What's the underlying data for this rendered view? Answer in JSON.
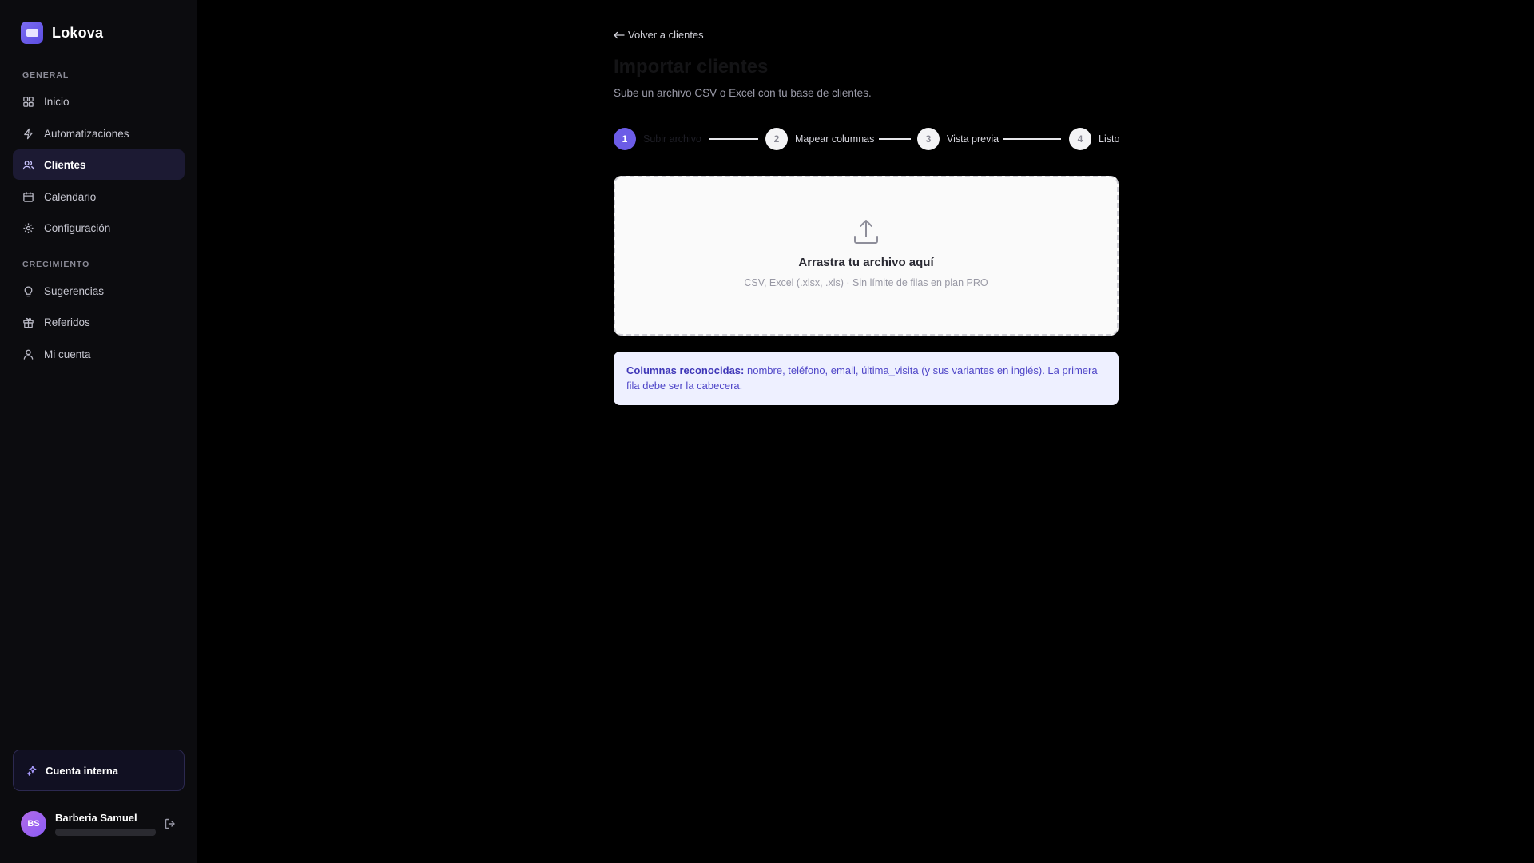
{
  "app": {
    "name": "Lokova"
  },
  "sidebar": {
    "sections": [
      {
        "label": "GENERAL"
      },
      {
        "label": "CRECIMIENTO"
      }
    ],
    "items": [
      {
        "label": "Inicio",
        "icon": "grid-icon"
      },
      {
        "label": "Automatizaciones",
        "icon": "lightning-icon"
      },
      {
        "label": "Clientes",
        "icon": "users-icon",
        "active": true
      },
      {
        "label": "Calendario",
        "icon": "calendar-icon"
      },
      {
        "label": "Configuración",
        "icon": "gear-icon"
      },
      {
        "label": "Sugerencias",
        "icon": "lightbulb-icon"
      },
      {
        "label": "Referidos",
        "icon": "gift-icon"
      },
      {
        "label": "Mi cuenta",
        "icon": "user-icon"
      }
    ],
    "internal_account": {
      "label": "Cuenta interna",
      "icon": "sparkle-icon"
    },
    "user": {
      "initials": "BS",
      "name": "Barberia Samuel"
    }
  },
  "main": {
    "back_link": "Volver a clientes",
    "title": "Importar clientes",
    "subtitle": "Sube un archivo CSV o Excel con tu base de clientes.",
    "steps": [
      {
        "number": "1",
        "label": "Subir archivo",
        "active": true
      },
      {
        "number": "2",
        "label": "Mapear columnas"
      },
      {
        "number": "3",
        "label": "Vista previa"
      },
      {
        "number": "4",
        "label": "Listo"
      }
    ],
    "dropzone": {
      "title": "Arrastra tu archivo aquí",
      "subtitle": "CSV, Excel (.xlsx, .xls) · Sin límite de filas en plan PRO"
    },
    "info": {
      "bold": "Columnas reconocidas:",
      "text": " nombre, teléfono, email, última_visita (y sus variantes en inglés). La primera fila debe ser la cabecera."
    }
  },
  "colors": {
    "accent": "#6c5ce7",
    "sidebar_bg": "#0c0c0f",
    "active_item_bg": "#1c1a33",
    "info_bg": "#eef0ff",
    "info_text": "#4f46c8"
  }
}
